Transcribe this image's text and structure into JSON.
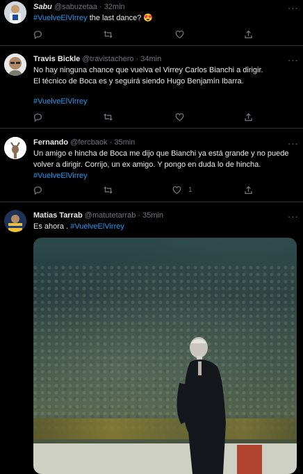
{
  "tweets": [
    {
      "name": "Sabu",
      "handle": "@sabuzetaa",
      "time": "32min",
      "lines": [
        {
          "hashtag": "#VuelveElVirrey",
          "text": " the last dance? 😍"
        }
      ],
      "actions": {
        "reply": "",
        "retweet": "",
        "like": ""
      }
    },
    {
      "name": "Travis Bickle",
      "handle": "@travistachero",
      "time": "34min",
      "lines": [
        "No hay ninguna chance que vuelva el Virrey Carlos Bianchi a dirigir.",
        "El técnico de Boca es y seguirá siendo Hugo Benjamín Ibarra."
      ],
      "hashtag": "#VuelveElVirrey",
      "actions": {
        "reply": "",
        "retweet": "",
        "like": ""
      }
    },
    {
      "name": "Fernando",
      "handle": "@fercbaok",
      "time": "35min",
      "lines": [
        "Un amigo e hincha de Boca me dijo que Bianchi ya está grande y no puede",
        "volver a dirigir. Corrijo, un ex amigo. Y pongo en duda lo de hincha."
      ],
      "hashtag": "#VuelveElVirrey",
      "actions": {
        "reply": "",
        "retweet": "",
        "like": "1"
      }
    },
    {
      "name": "Matias Tarrab",
      "handle": "@matutetarrab",
      "time": "35min",
      "text": "Es ahora . ",
      "hashtag": "#VuelveElVirrey"
    }
  ],
  "ui": {
    "separator": " · ",
    "more": "···",
    "accent": "#1d9bf0",
    "muted": "#71767b"
  }
}
